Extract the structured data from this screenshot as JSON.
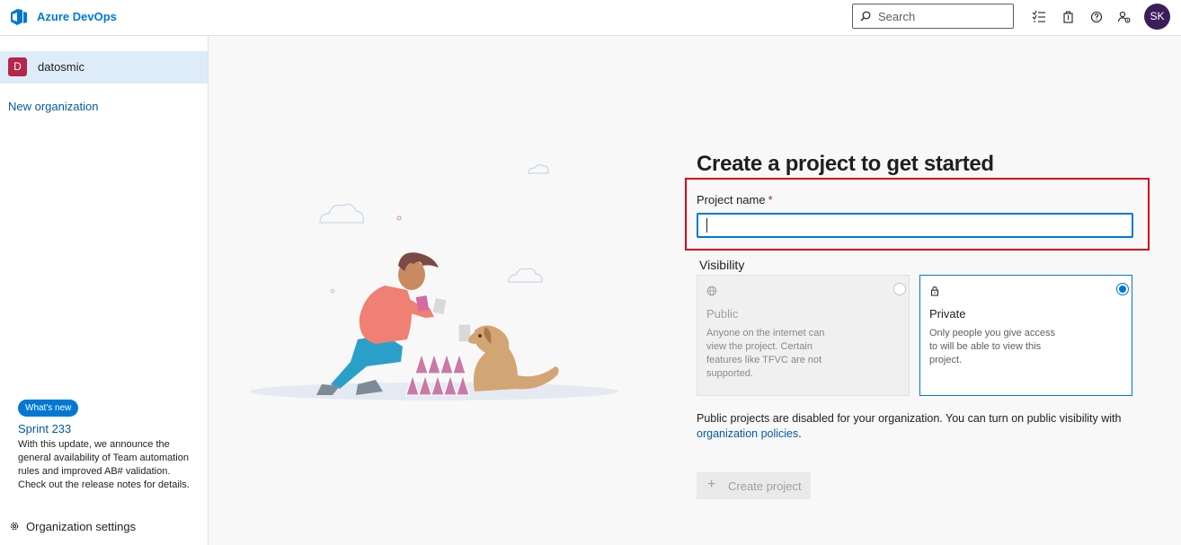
{
  "header": {
    "brand": "Azure DevOps",
    "search_placeholder": "Search",
    "avatar_initials": "SK"
  },
  "sidebar": {
    "org": {
      "initial": "D",
      "name": "datosmic"
    },
    "new_org": "New organization",
    "whats_new": {
      "badge": "What's new",
      "title": "Sprint 233",
      "description": "With this update, we announce the general availability of Team automation rules and improved AB# validation. Check out the release notes for details."
    },
    "settings_label": "Organization settings"
  },
  "main": {
    "title": "Create a project to get started",
    "project_name_label": "Project name",
    "required_marker": "*",
    "project_name_value": "",
    "visibility_label": "Visibility",
    "visibility_options": [
      {
        "title": "Public",
        "description": "Anyone on the internet can view the project. Certain features like TFVC are not supported.",
        "selected": false,
        "disabled": true
      },
      {
        "title": "Private",
        "description": "Only people you give access to will be able to view this project.",
        "selected": true,
        "disabled": false
      }
    ],
    "public_note": "Public projects are disabled for your organization. You can turn on public visibility with",
    "public_note_link": "organization policies",
    "public_note_end": ".",
    "create_button": "Create project",
    "create_button_icon": "plus-icon"
  },
  "colors": {
    "accent": "#0078d4",
    "highlight_border": "#d0021b",
    "org_badge": "#b4264a",
    "avatar": "#3b1d5c"
  }
}
